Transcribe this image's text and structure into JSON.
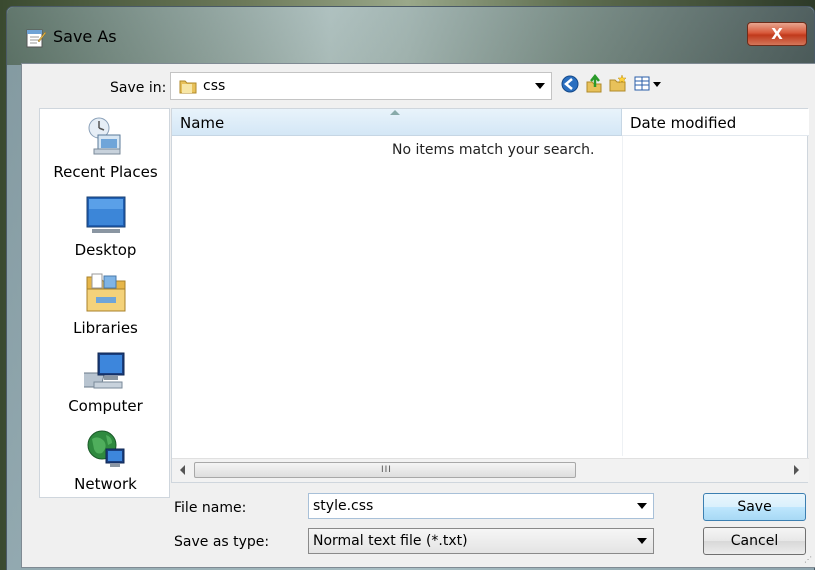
{
  "window": {
    "title": "Save As",
    "close_label": "X"
  },
  "save_in": {
    "label": "Save in:",
    "value": "css"
  },
  "toolbar": {
    "icons": [
      "back-icon",
      "up-folder-icon",
      "new-folder-icon",
      "view-menu-icon"
    ]
  },
  "places": [
    {
      "label": "Recent Places",
      "icon": "recent-places-icon"
    },
    {
      "label": "Desktop",
      "icon": "desktop-icon"
    },
    {
      "label": "Libraries",
      "icon": "libraries-icon"
    },
    {
      "label": "Computer",
      "icon": "computer-icon"
    },
    {
      "label": "Network",
      "icon": "network-icon"
    }
  ],
  "file_list": {
    "columns": [
      "Name",
      "Date modified"
    ],
    "empty_message": "No items match your search.",
    "scroll_grip": "III"
  },
  "file_name": {
    "label": "File name:",
    "value": "style.css"
  },
  "save_as_type": {
    "label": "Save as type:",
    "value": "Normal text file (*.txt)"
  },
  "buttons": {
    "save": "Save",
    "cancel": "Cancel"
  },
  "colors": {
    "default_button": "#bee6fd",
    "close_button": "#d8593b",
    "header_highlight": "#d4e7f6"
  }
}
